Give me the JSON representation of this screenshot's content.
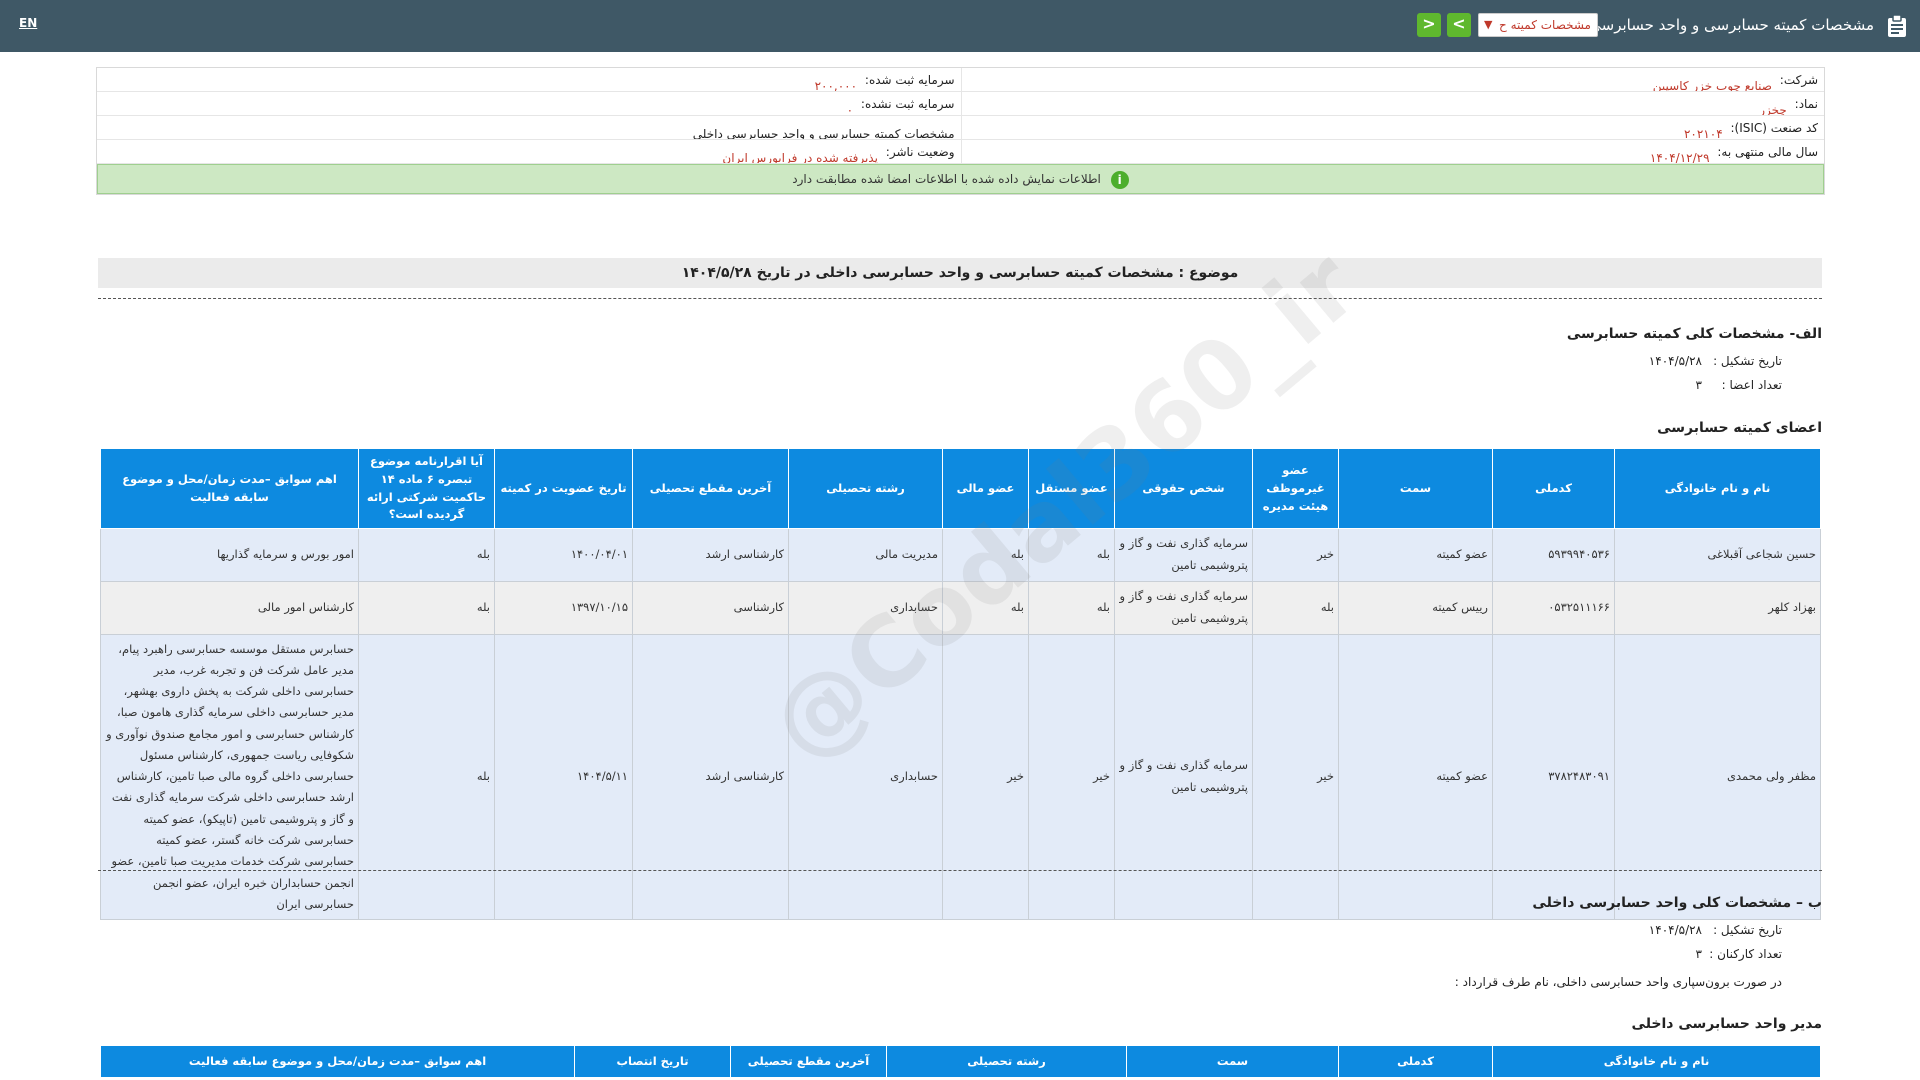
{
  "header": {
    "title": "مشخصات کمیته حسابرسی و واحد حسابرسی داخلی",
    "select_value": "مشخصات کمیته ح",
    "next_label": ">",
    "prev_label": "<",
    "lang_label": "EN"
  },
  "info": {
    "company_label": "شرکت:",
    "company_value": "صنایع چوب خزر کاسپین",
    "capital_reg_label": "سرمایه ثبت شده:",
    "capital_reg_value": "۲۰۰,۰۰۰",
    "symbol_label": "نماد:",
    "symbol_value": "چخزر",
    "capital_unreg_label": "سرمایه ثبت نشده:",
    "capital_unreg_value": "۰",
    "isic_label": "کد صنعت (ISIC):",
    "isic_value": "۲۰۲۱۰۴",
    "report_type_value": "مشخصات کمیته حسابرسی و واحد حسابرسی داخلی",
    "fiscal_label": "سال مالی منتهی به:",
    "fiscal_value": "۱۴۰۴/۱۲/۲۹",
    "publisher_label": "وضعیت ناشر:",
    "publisher_value": "پذیرفته شده در فرابورس ایران",
    "notice": "اطلاعات نمایش داده شده با اطلاعات امضا شده مطابقت دارد"
  },
  "subject": "موضوع : مشخصات کمیته حسابرسی و واحد حسابرسی داخلی در تاریخ ۱۴۰۴/۵/۲۸",
  "section_a": {
    "title": "الف- مشخصات کلی کمیته حسابرسی",
    "formation_label": "تاریخ تشکیل :",
    "formation_value": "۱۴۰۴/۵/۲۸",
    "members_count_label": "تعداد اعضا :",
    "members_count_value": "۳",
    "members_title": "اعضای کمیته حسابرسی"
  },
  "members_table": {
    "headers": [
      "نام و نام خانوادگی",
      "کدملی",
      "سمت",
      "عضو غیرموظف هیئت مدیره",
      "شخص حقوقی",
      "عضو مستقل",
      "عضو مالی",
      "رشته تحصیلی",
      "آخرین مقطع تحصیلی",
      "تاریخ عضویت در کمیته",
      "آیا اقرارنامه موضوع تبصره ۶ ماده ۱۴ حاکمیت شرکتی ارائه گردیده است؟",
      "اهم سوابق –مدت زمان/محل و موضوع سابقه فعالیت"
    ],
    "rows": [
      [
        "حسین شجاعی آقبلاغی",
        "۵۹۳۹۹۴۰۵۳۶",
        "عضو کمیته",
        "خیر",
        "سرمایه گذاری نفت و گاز و پتروشیمی تامین",
        "بله",
        "بله",
        "مدیریت مالی",
        "کارشناسی ارشد",
        "۱۴۰۰/۰۴/۰۱",
        "بله",
        "امور بورس و سرمایه گذاریها"
      ],
      [
        "بهزاد کلهر",
        "۰۵۳۲۵۱۱۱۶۶",
        "رییس کمیته",
        "بله",
        "سرمایه گذاری نفت و گاز و پتروشیمی تامین",
        "بله",
        "بله",
        "حسابداری",
        "کارشناسی",
        "۱۳۹۷/۱۰/۱۵",
        "بله",
        "کارشناس امور مالی"
      ],
      [
        "مظفر ولی محمدی",
        "۳۷۸۲۴۸۳۰۹۱",
        "عضو کمیته",
        "خیر",
        "سرمایه گذاری نفت و گاز و پتروشیمی تامین",
        "خیر",
        "خیر",
        "حسابداری",
        "کارشناسی ارشد",
        "۱۴۰۴/۵/۱۱",
        "بله",
        "حسابرس مستقل موسسه حسابرسی راهبرد پیام، مدیر عامل شرکت فن و تجربه غرب، مدیر حسابرسی داخلی شرکت به پخش داروی بهشهر، مدیر حسابرسی داخلی سرمایه گذاری هامون صبا، کارشناس حسابرسی و امور مجامع صندوق نوآوری و شکوفایی ریاست جمهوری، کارشناس مسئول حسابرسی داخلی گروه مالی صبا تامین، کارشناس ارشد حسابرسی داخلی شرکت سرمایه گذاری نفت و گاز و پتروشیمی تامین (تاپیکو)، عضو کمیته حسابرسی شرکت خانه گستر، عضو کمیته حسابرسی شرکت خدمات مدیریت صبا تامین، عضو انجمن حسابداران خبره ایران، عضو انجمن حسابرسی ایران"
      ]
    ]
  },
  "section_b": {
    "title": "ب – مشخصات کلی واحد حسابرسی داخلی",
    "formation_label": "تاریخ تشکیل :",
    "formation_value": "۱۴۰۴/۵/۲۸",
    "staff_label": "تعداد کارکنان :",
    "staff_value": "۳",
    "outsourcing_label": "در صورت برون‌سپاری واحد حسابرسی داخلی، نام طرف قرارداد :",
    "manager_title": "مدیر واحد حسابرسی داخلی"
  },
  "manager_table": {
    "headers": [
      "نام و نام خانوادگی",
      "کدملی",
      "سمت",
      "رشته تحصیلی",
      "آخرین مقطع تحصیلی",
      "تاریخ انتصاب",
      "اهم سوابق –مدت زمان/محل و موضوع سابقه فعالیت"
    ]
  },
  "watermark": "@Codal360_ir"
}
